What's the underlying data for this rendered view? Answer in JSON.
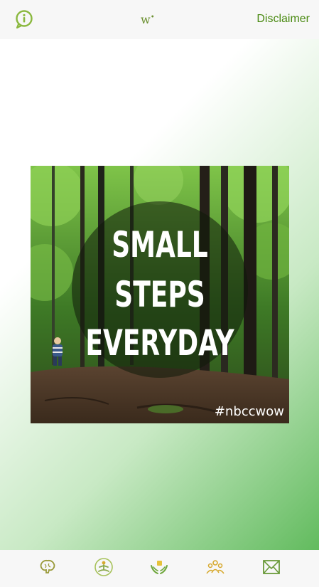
{
  "header": {
    "info_icon": "info-icon",
    "logo_text": "w",
    "disclaimer_label": "Disclaimer"
  },
  "poster": {
    "line1": "SMALL",
    "line2": "STEPS",
    "line3": "EVERYDAY",
    "hashtag": "#nbccwow"
  },
  "bottom_nav": {
    "items": [
      {
        "icon": "brain-icon"
      },
      {
        "icon": "meditation-icon"
      },
      {
        "icon": "care-hands-icon"
      },
      {
        "icon": "community-icon"
      },
      {
        "icon": "mail-icon"
      }
    ]
  },
  "colors": {
    "accent": "#6a9a2e",
    "disclaimer": "#4a8a12",
    "gradient_end": "#62bb5e"
  }
}
